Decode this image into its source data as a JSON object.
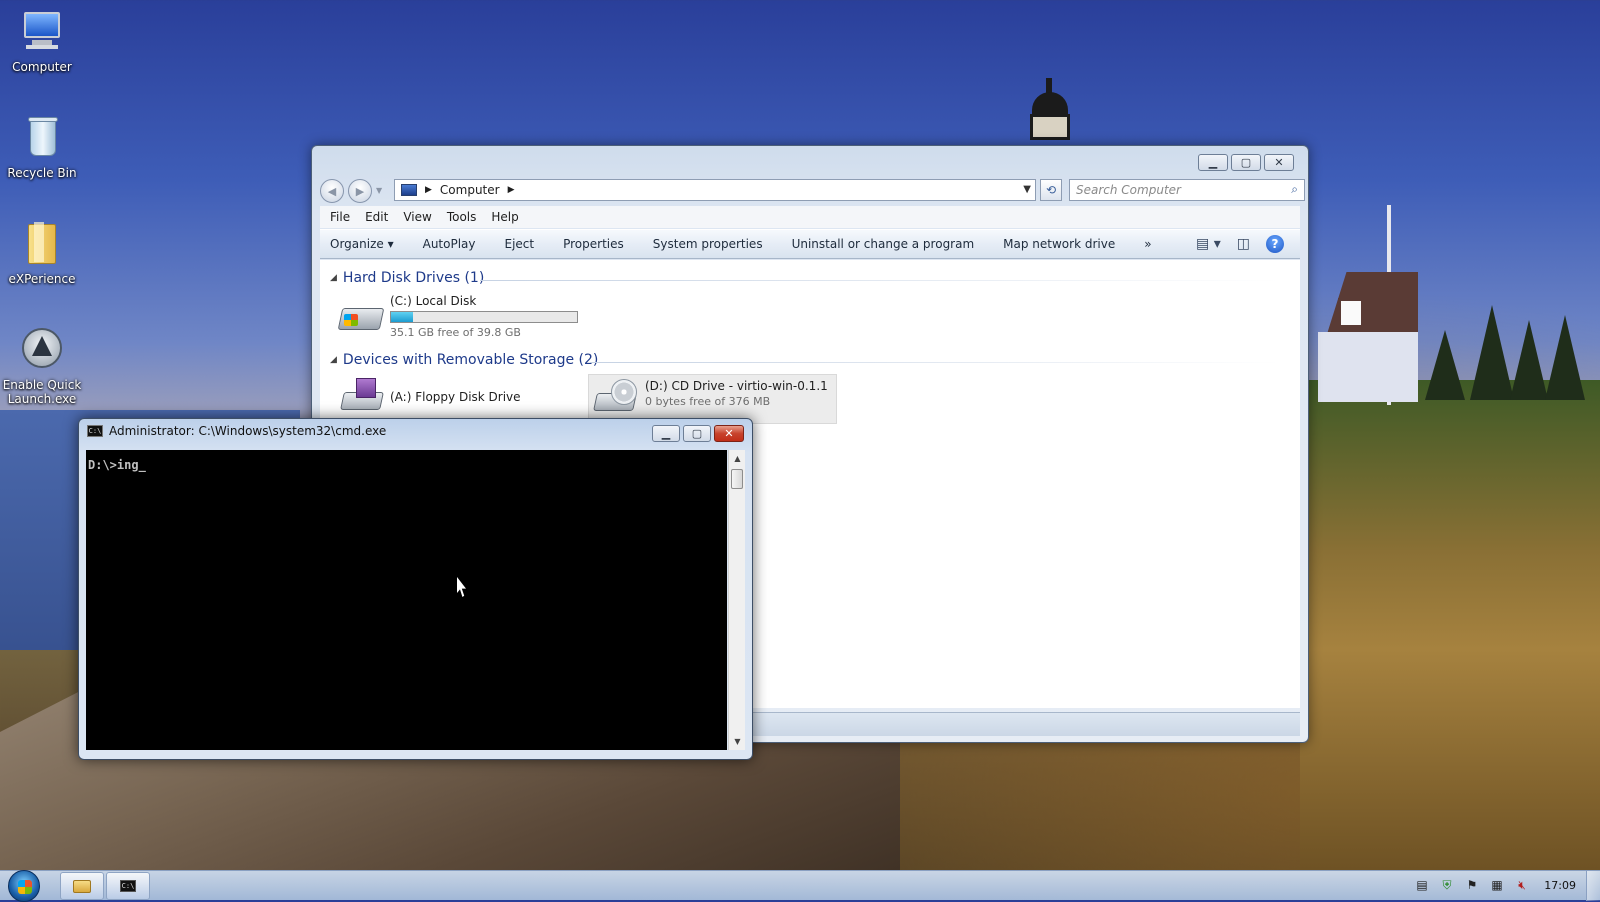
{
  "desktop": {
    "icons": [
      {
        "label": "Computer",
        "icon": "computer-icon"
      },
      {
        "label": "Recycle Bin",
        "icon": "recycle-bin-icon"
      },
      {
        "label": "eXPerience",
        "icon": "folder-icon"
      },
      {
        "label": "Enable Quick Launch.exe",
        "icon": "quick-launch-icon"
      }
    ]
  },
  "explorer": {
    "breadcrumb": "Computer",
    "search_placeholder": "Search Computer",
    "menu": [
      "File",
      "Edit",
      "View",
      "Tools",
      "Help"
    ],
    "toolbar": [
      "Organize ▾",
      "AutoPlay",
      "Eject",
      "Properties",
      "System properties",
      "Uninstall or change a program",
      "Map network drive",
      "»"
    ],
    "groups": [
      {
        "title": "Hard Disk Drives (1)",
        "drives": [
          {
            "name": "(C:) Local Disk",
            "detail": "35.1 GB free of 39.8 GB",
            "used_fraction": 0.12
          }
        ]
      },
      {
        "title": "Devices with Removable Storage (2)",
        "drives": [
          {
            "name": "(A:) Floppy Disk Drive",
            "detail": ""
          },
          {
            "name": "(D:) CD Drive - virtio-win-0.1.1",
            "detail": "0 bytes free of 376 MB"
          }
        ]
      }
    ]
  },
  "cmd": {
    "title": "Administrator: C:\\Windows\\system32\\cmd.exe",
    "prompt_line": "D:\\>ing_"
  },
  "taskbar": {
    "clock": "17:09",
    "tasks": [
      "folder-icon",
      "cmd-icon"
    ],
    "tray_icons": [
      "document-icon",
      "shield-icon",
      "flag-icon",
      "network-icon",
      "volume-muted-icon"
    ]
  },
  "colors": {
    "accent": "#1e3a8a",
    "disk_fill": "#1c9cd0",
    "close_button": "#c7432d"
  }
}
